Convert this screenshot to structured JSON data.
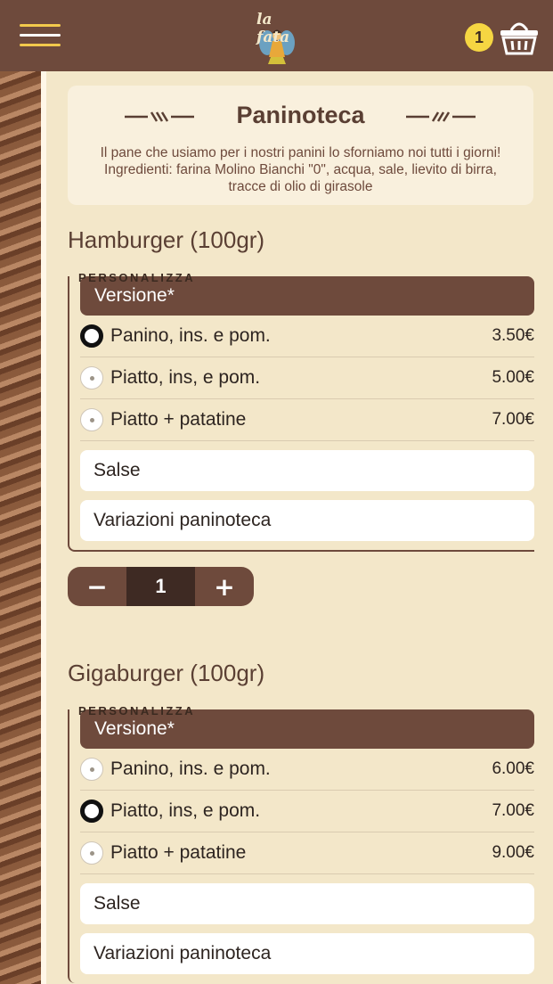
{
  "header": {
    "logo_text": "la fata",
    "cart_count": "1"
  },
  "intro": {
    "title": "Paninoteca",
    "description": "Il pane che usiamo per i nostri panini lo sforniamo noi tutti i giorni! Ingredienti: farina Molino Bianchi \"0\", acqua, sale, lievito di birra, tracce di olio di girasole"
  },
  "products": [
    {
      "title": "Hamburger (100gr)",
      "section_label": "PERSONALIZZA",
      "version_label": "Versione*",
      "options": [
        {
          "label": "Panino, ins. e pom.",
          "price": "3.50€",
          "selected": true
        },
        {
          "label": "Piatto, ins, e pom.",
          "price": "5.00€",
          "selected": false
        },
        {
          "label": "Piatto + patatine",
          "price": "7.00€",
          "selected": false
        }
      ],
      "sauces_label": "Salse",
      "variations_label": "Variazioni paninoteca",
      "quantity": "1",
      "minus_label": "−",
      "plus_label": "+"
    },
    {
      "title": "Gigaburger (100gr)",
      "section_label": "PERSONALIZZA",
      "version_label": "Versione*",
      "options": [
        {
          "label": "Panino, ins. e pom.",
          "price": "6.00€",
          "selected": false
        },
        {
          "label": "Piatto, ins, e pom.",
          "price": "7.00€",
          "selected": true
        },
        {
          "label": "Piatto + patatine",
          "price": "9.00€",
          "selected": false
        }
      ],
      "sauces_label": "Salse",
      "variations_label": "Variazioni paninoteca"
    }
  ],
  "colors": {
    "header_bg": "#6e4a3c",
    "accent_yellow": "#f5d642",
    "page_bg": "#f3e7c9"
  }
}
